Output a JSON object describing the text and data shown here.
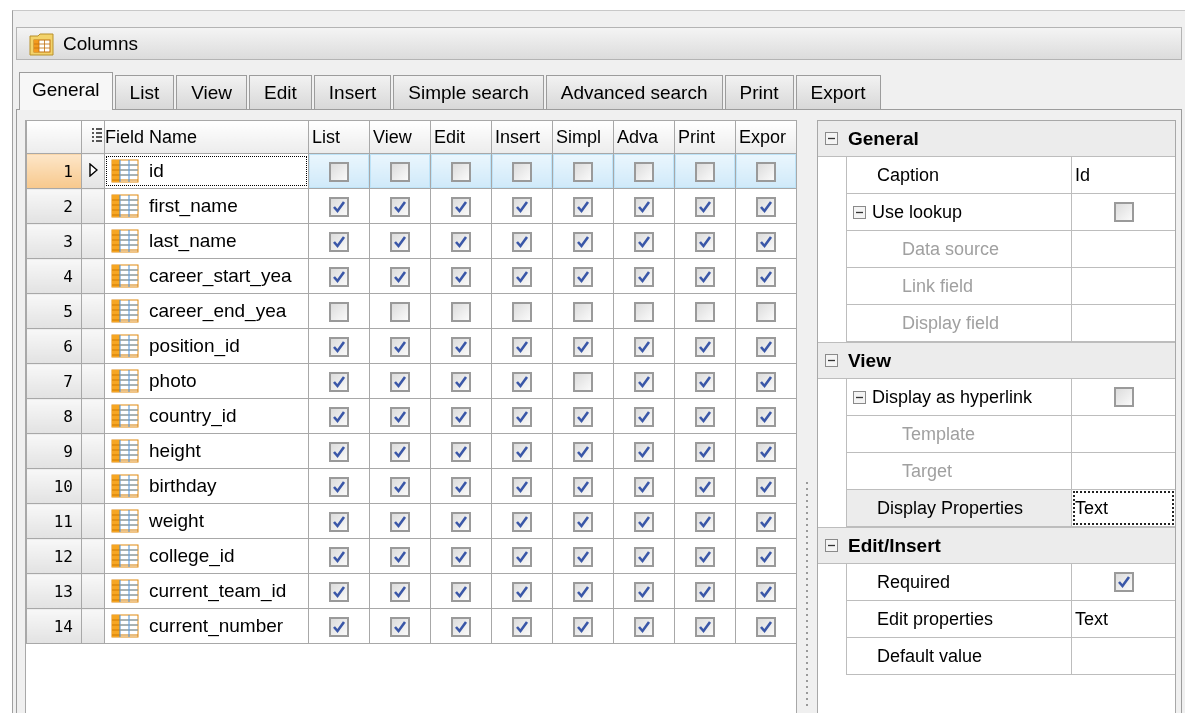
{
  "panel": {
    "title": "Columns"
  },
  "tabs": [
    {
      "label": "General",
      "selected": true
    },
    {
      "label": "List",
      "selected": false
    },
    {
      "label": "View",
      "selected": false
    },
    {
      "label": "Edit",
      "selected": false
    },
    {
      "label": "Insert",
      "selected": false
    },
    {
      "label": "Simple search",
      "selected": false
    },
    {
      "label": "Advanced search",
      "selected": false
    },
    {
      "label": "Print",
      "selected": false
    },
    {
      "label": "Export",
      "selected": false
    }
  ],
  "grid": {
    "columns": [
      "Field Name",
      "List",
      "View",
      "Edit",
      "Insert",
      "Simpl",
      "Adva",
      "Print",
      "Expor"
    ],
    "rows": [
      {
        "number": "1",
        "name": "id",
        "selected": true,
        "flags": [
          false,
          false,
          false,
          false,
          false,
          false,
          false,
          false
        ]
      },
      {
        "number": "2",
        "name": "first_name",
        "selected": false,
        "flags": [
          true,
          true,
          true,
          true,
          true,
          true,
          true,
          true
        ]
      },
      {
        "number": "3",
        "name": "last_name",
        "selected": false,
        "flags": [
          true,
          true,
          true,
          true,
          true,
          true,
          true,
          true
        ]
      },
      {
        "number": "4",
        "name": "career_start_yea",
        "selected": false,
        "flags": [
          true,
          true,
          true,
          true,
          true,
          true,
          true,
          true
        ]
      },
      {
        "number": "5",
        "name": "career_end_yea",
        "selected": false,
        "flags": [
          false,
          false,
          false,
          false,
          false,
          false,
          false,
          false
        ]
      },
      {
        "number": "6",
        "name": "position_id",
        "selected": false,
        "flags": [
          true,
          true,
          true,
          true,
          true,
          true,
          true,
          true
        ]
      },
      {
        "number": "7",
        "name": "photo",
        "selected": false,
        "flags": [
          true,
          true,
          true,
          true,
          false,
          true,
          true,
          true
        ]
      },
      {
        "number": "8",
        "name": "country_id",
        "selected": false,
        "flags": [
          true,
          true,
          true,
          true,
          true,
          true,
          true,
          true
        ]
      },
      {
        "number": "9",
        "name": "height",
        "selected": false,
        "flags": [
          true,
          true,
          true,
          true,
          true,
          true,
          true,
          true
        ]
      },
      {
        "number": "10",
        "name": "birthday",
        "selected": false,
        "flags": [
          true,
          true,
          true,
          true,
          true,
          true,
          true,
          true
        ]
      },
      {
        "number": "11",
        "name": "weight",
        "selected": false,
        "flags": [
          true,
          true,
          true,
          true,
          true,
          true,
          true,
          true
        ]
      },
      {
        "number": "12",
        "name": "college_id",
        "selected": false,
        "flags": [
          true,
          true,
          true,
          true,
          true,
          true,
          true,
          true
        ]
      },
      {
        "number": "13",
        "name": "current_team_id",
        "selected": false,
        "flags": [
          true,
          true,
          true,
          true,
          true,
          true,
          true,
          true
        ]
      },
      {
        "number": "14",
        "name": "current_number",
        "selected": false,
        "flags": [
          true,
          true,
          true,
          true,
          true,
          true,
          true,
          true
        ]
      }
    ]
  },
  "properties": [
    {
      "category": "General",
      "expanded": true,
      "items": [
        {
          "label": "Caption",
          "kind": "text",
          "value": "Id",
          "disabled": false,
          "selected": false
        },
        {
          "label": "Use lookup",
          "kind": "check",
          "checked": false,
          "expanded": true,
          "disabled": false,
          "selected": false,
          "children": [
            {
              "label": "Data source",
              "disabled": true,
              "selected": false
            },
            {
              "label": "Link field",
              "disabled": true,
              "selected": false
            },
            {
              "label": "Display field",
              "disabled": true,
              "selected": false
            }
          ]
        }
      ]
    },
    {
      "category": "View",
      "expanded": true,
      "items": [
        {
          "label": "Display as hyperlink",
          "kind": "check",
          "checked": false,
          "expanded": true,
          "disabled": false,
          "selected": false,
          "children": [
            {
              "label": "Template",
              "disabled": true,
              "selected": false
            },
            {
              "label": "Target",
              "disabled": true,
              "selected": false
            }
          ]
        },
        {
          "label": "Display Properties",
          "kind": "text",
          "value": "Text",
          "disabled": false,
          "selected": true
        }
      ]
    },
    {
      "category": "Edit/Insert",
      "expanded": true,
      "items": [
        {
          "label": "Required",
          "kind": "check",
          "checked": true,
          "disabled": false,
          "selected": false
        },
        {
          "label": "Edit properties",
          "kind": "text",
          "value": "Text",
          "disabled": false,
          "selected": false
        },
        {
          "label": "Default value",
          "disabled": false,
          "selected": false
        }
      ]
    }
  ]
}
